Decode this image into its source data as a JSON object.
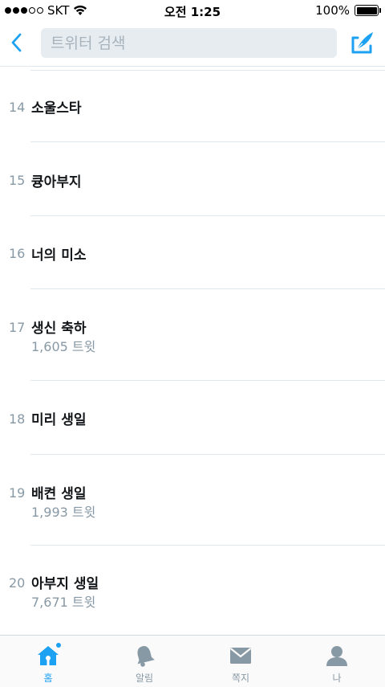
{
  "status_bar": {
    "carrier": "SKT",
    "time": "오전 1:25",
    "battery_text": "100%",
    "battery_level": 1.0
  },
  "nav": {
    "search_placeholder": "트위터 검색"
  },
  "trends": [
    {
      "rank": "14",
      "name": "소울스타",
      "count": ""
    },
    {
      "rank": "15",
      "name": "큥아부지",
      "count": ""
    },
    {
      "rank": "16",
      "name": "너의 미소",
      "count": ""
    },
    {
      "rank": "17",
      "name": "생신 축하",
      "count": "1,605 트윗"
    },
    {
      "rank": "18",
      "name": "미리 생일",
      "count": ""
    },
    {
      "rank": "19",
      "name": "배켠 생일",
      "count": "1,993 트윗"
    },
    {
      "rank": "20",
      "name": "아부지 생일",
      "count": "7,671 트윗"
    }
  ],
  "tabs": [
    {
      "label": "홈",
      "icon": "home-icon",
      "active": true
    },
    {
      "label": "알림",
      "icon": "bell-icon",
      "active": false
    },
    {
      "label": "쪽지",
      "icon": "envelope-icon",
      "active": false
    },
    {
      "label": "나",
      "icon": "person-icon",
      "active": false
    }
  ],
  "colors": {
    "accent": "#1da1f2",
    "muted": "#8899a6",
    "divider": "#e1e8ed"
  }
}
